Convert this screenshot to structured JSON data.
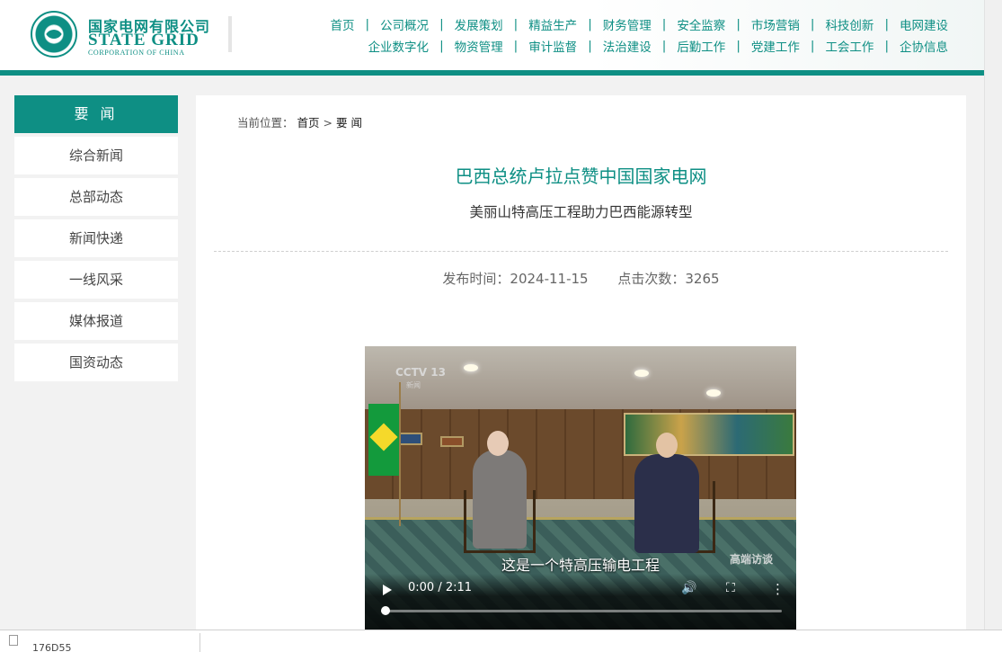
{
  "logo": {
    "cn": "国家电网有限公司",
    "en": "STATE GRID",
    "sub": "CORPORATION OF CHINA"
  },
  "nav": {
    "row1": [
      "首页",
      "公司概况",
      "发展策划",
      "精益生产",
      "财务管理",
      "安全监察",
      "市场营销",
      "科技创新",
      "电网建设"
    ],
    "row2": [
      "企业数字化",
      "物资管理",
      "审计监督",
      "法治建设",
      "后勤工作",
      "党建工作",
      "工会工作",
      "企协信息"
    ],
    "separator": "|"
  },
  "sidebar": {
    "header": "要 闻",
    "items": [
      "综合新闻",
      "总部动态",
      "新闻快递",
      "一线风采",
      "媒体报道",
      "国资动态"
    ]
  },
  "breadcrumb": {
    "prefix": "当前位置：",
    "home": "首页",
    "sep": ">",
    "current": "要 闻"
  },
  "article": {
    "title": "巴西总统卢拉点赞中国国家电网",
    "subtitle": "美丽山特高压工程助力巴西能源转型",
    "publish_label": "发布时间：2024-11-15",
    "clicks_label": "点击次数：3265"
  },
  "video": {
    "channel_logo": "CCTV 13",
    "channel_sub": "新闻",
    "corner_logo": "高端访谈",
    "caption": "这是一个特高压输电工程",
    "time": "0:00 / 2:11",
    "progress": 0
  },
  "download": {
    "file": "176D55"
  },
  "colors": {
    "accent": "#0e8f84"
  }
}
